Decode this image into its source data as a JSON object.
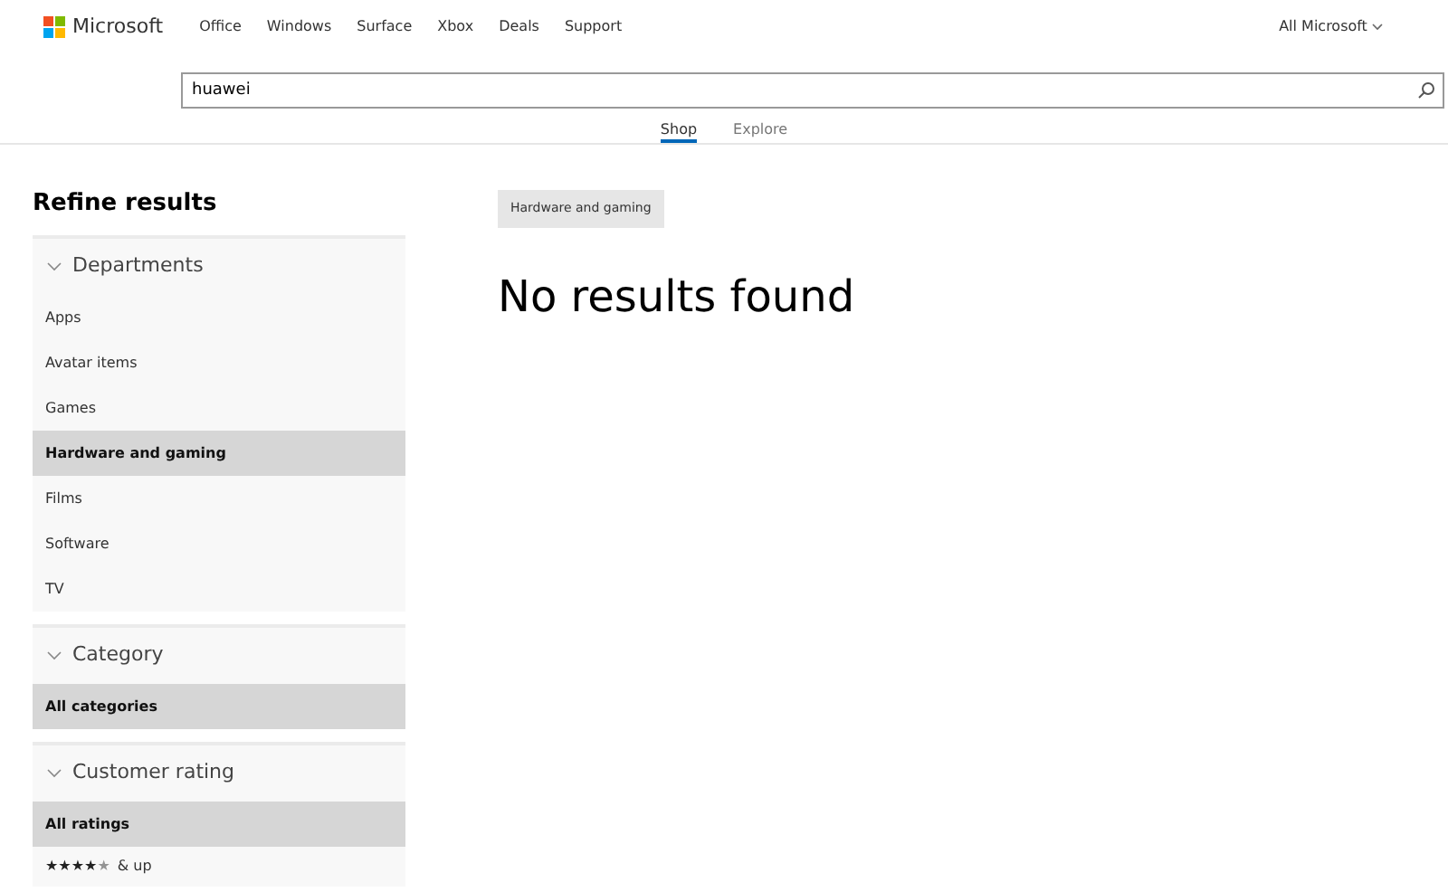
{
  "header": {
    "logo": "Microsoft",
    "nav": [
      "Office",
      "Windows",
      "Surface",
      "Xbox",
      "Deals",
      "Support"
    ],
    "all_microsoft": "All Microsoft"
  },
  "search": {
    "value": "huawei"
  },
  "tabs": [
    {
      "label": "Shop",
      "selected": true
    },
    {
      "label": "Explore",
      "selected": false
    }
  ],
  "sidebar": {
    "title": "Refine results",
    "sections": [
      {
        "title": "Departments",
        "items": [
          {
            "label": "Apps",
            "selected": false
          },
          {
            "label": "Avatar items",
            "selected": false
          },
          {
            "label": "Games",
            "selected": false
          },
          {
            "label": "Hardware and gaming",
            "selected": true
          },
          {
            "label": "Films",
            "selected": false
          },
          {
            "label": "Software",
            "selected": false
          },
          {
            "label": "TV",
            "selected": false
          }
        ]
      },
      {
        "title": "Category",
        "items": [
          {
            "label": "All categories",
            "selected": true
          }
        ]
      },
      {
        "title": "Customer rating",
        "items": [
          {
            "label": "All ratings",
            "selected": true
          },
          {
            "kind": "stars",
            "stars": 4,
            "label": "& up",
            "selected": false
          }
        ]
      }
    ]
  },
  "main": {
    "filter_chip": "Hardware and gaming",
    "message": "No results found"
  }
}
